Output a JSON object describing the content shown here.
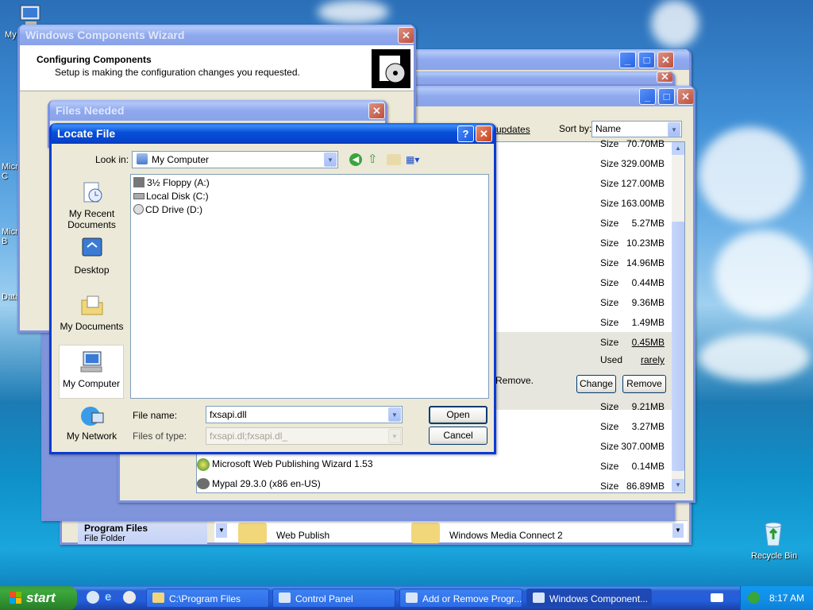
{
  "desktop": {
    "icon_labels": [
      "My",
      "Micro C",
      "Micro B",
      "Data"
    ],
    "recycle_bin": "Recycle Bin"
  },
  "wizard": {
    "title": "Windows Components Wizard",
    "heading": "Configuring Components",
    "subheading": "Setup is making the configuration changes you requested."
  },
  "addremove": {
    "show_updates": "updates",
    "sort_by_label": "Sort by:",
    "sort_by_value": "Name",
    "size_label": "Size",
    "used_label": "Used",
    "used_value": "rarely",
    "remove_text": "Remove.",
    "change_button": "Change",
    "remove_button": "Remove",
    "sizes_top": [
      "70.70MB",
      "329.00MB",
      "127.00MB",
      "163.00MB",
      "5.27MB",
      "10.23MB",
      "14.96MB",
      "0.44MB",
      "9.36MB",
      "1.49MB"
    ],
    "selected_size": "0.45MB",
    "sizes_bottom": [
      "9.21MB",
      "3.27MB",
      "307.00MB",
      "0.14MB",
      "86.89MB"
    ],
    "programs": [
      {
        "name": "Microsoft Web Publishing Wizard 1.53",
        "size": "0.14MB"
      },
      {
        "name": "Mypal 29.3.0 (x86 en-US)",
        "size": "86.89MB"
      }
    ]
  },
  "explorer": {
    "selected_folder": "Program Files",
    "selected_type": "File Folder",
    "items": [
      "Web Publish",
      "Windows Media Connect 2"
    ]
  },
  "files_needed": {
    "title": "Files Needed"
  },
  "locate": {
    "title": "Locate File",
    "look_in_label": "Look in:",
    "look_in_value": "My Computer",
    "places": [
      "My Recent Documents",
      "Desktop",
      "My Documents",
      "My Computer",
      "My Network"
    ],
    "items": [
      "3½ Floppy (A:)",
      "Local Disk (C:)",
      "CD Drive (D:)"
    ],
    "file_name_label": "File name:",
    "file_name_value": "fxsapi.dll",
    "file_type_label": "Files of type:",
    "file_type_value": "fxsapi.dl;fxsapi.dl_",
    "open_button": "Open",
    "cancel_button": "Cancel"
  },
  "taskbar": {
    "start": "start",
    "tasks": [
      "C:\\Program Files",
      "Control Panel",
      "Add or Remove Progr...",
      "Windows Component..."
    ],
    "clock": "8:17 AM"
  }
}
